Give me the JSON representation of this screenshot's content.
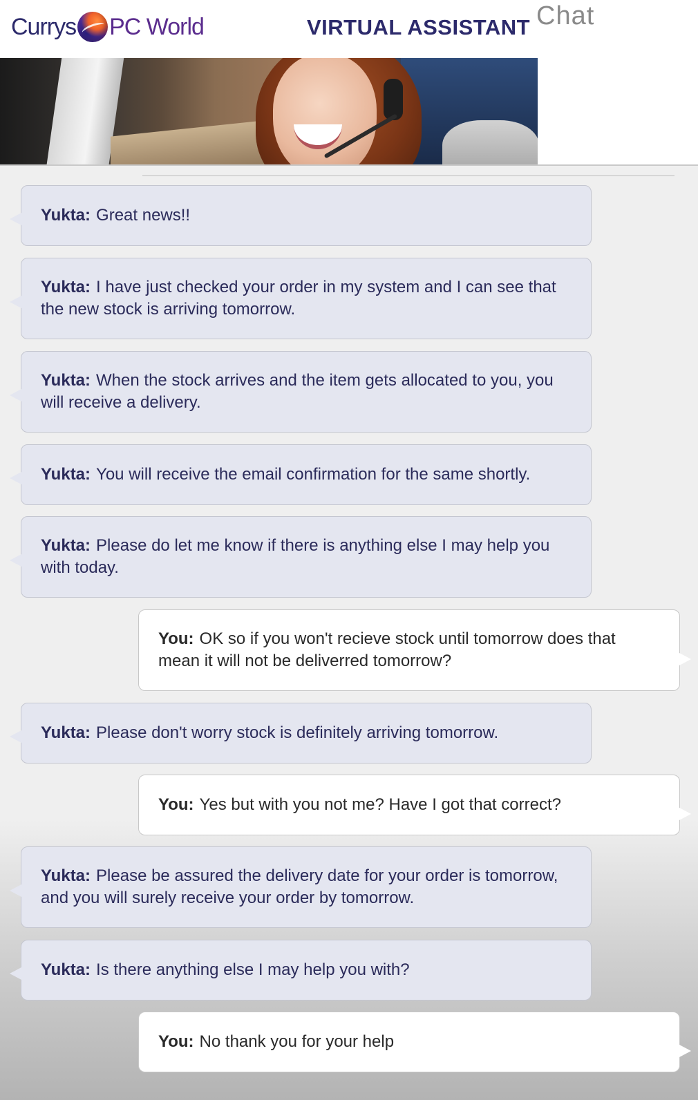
{
  "header": {
    "logo_part1": "Currys",
    "logo_part2": "PC World",
    "title": "VIRTUAL ASSISTANT",
    "subtitle": "Chat"
  },
  "messages": [
    {
      "sender": "Yukta:",
      "text": "Great news!!"
    },
    {
      "sender": "Yukta:",
      "text": "I have just checked your order in my system and I can see that the new stock is arriving tomorrow."
    },
    {
      "sender": "Yukta:",
      "text": "When the stock arrives and the item gets allocated to you, you will receive a delivery."
    },
    {
      "sender": "Yukta:",
      "text": "You will receive the email confirmation for the same shortly."
    },
    {
      "sender": "Yukta:",
      "text": "Please do let me know if there is anything else I may help you with today."
    },
    {
      "sender": "You:",
      "text": "OK so if you won't recieve stock until tomorrow does that mean it will not be deliverred tomorrow?"
    },
    {
      "sender": "Yukta:",
      "text": "Please don't worry stock is definitely arriving tomorrow."
    },
    {
      "sender": "You:",
      "text": "Yes but with you not me? Have I got that correct?"
    },
    {
      "sender": "Yukta:",
      "text": "Please be assured the delivery date for your order is tomorrow, and you will surely receive your order by tomorrow."
    },
    {
      "sender": "Yukta:",
      "text": "Is there anything else I may help you with?"
    },
    {
      "sender": "You:",
      "text": "No thank you for your help"
    }
  ]
}
